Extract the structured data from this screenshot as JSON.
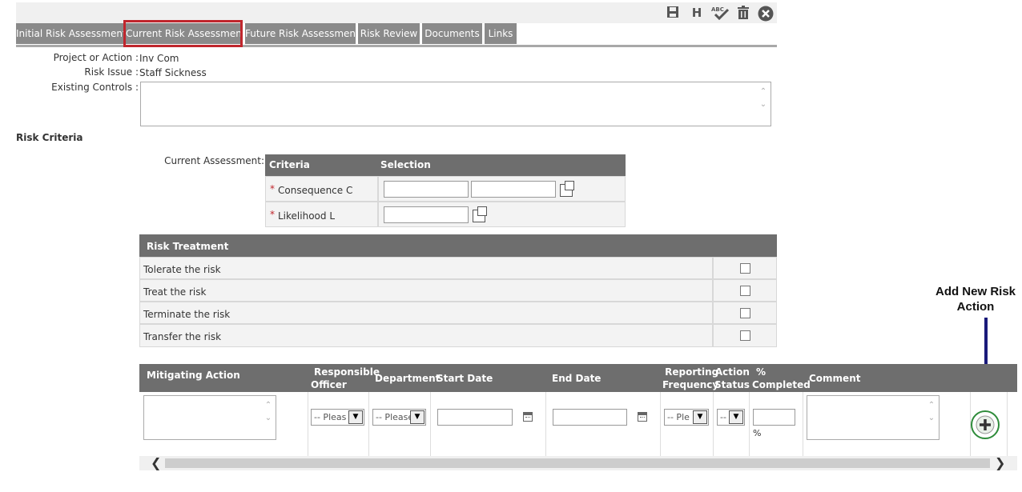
{
  "toolbar": {
    "icons": [
      "save-icon",
      "history-icon",
      "spellcheck-icon",
      "delete-icon",
      "close-icon"
    ],
    "history_label": "H",
    "spell_label": "ABC"
  },
  "tabs": [
    {
      "label": "Initial Risk Assessment"
    },
    {
      "label": "Current Risk Assessment"
    },
    {
      "label": "Future Risk Assessment"
    },
    {
      "label": "Risk Review"
    },
    {
      "label": "Documents"
    },
    {
      "label": "Links"
    }
  ],
  "details": {
    "project_label": "Project or Action :",
    "project_value": "Inv Com",
    "issue_label": "Risk Issue :",
    "issue_value": "Staff Sickness",
    "controls_label": "Existing Controls :",
    "controls_value": ""
  },
  "risk_criteria": {
    "section_title": "Risk Criteria",
    "current_assessment_label": "Current Assessment:",
    "col_criteria": "Criteria",
    "col_selection": "Selection",
    "rows": [
      {
        "required": "*",
        "label": "Consequence C"
      },
      {
        "required": "*",
        "label": "Likelihood L"
      }
    ]
  },
  "risk_treatment": {
    "header": "Risk Treatment",
    "options": [
      {
        "label": "Tolerate the risk",
        "checked": false
      },
      {
        "label": "Treat the risk",
        "checked": false
      },
      {
        "label": "Terminate the risk",
        "checked": false
      },
      {
        "label": "Transfer the risk",
        "checked": false
      }
    ]
  },
  "mitigation": {
    "headers": {
      "mitigating_action": "Mitigating Action",
      "responsible_officer_1": "Responsible",
      "responsible_officer_2": "Officer",
      "department": "Department",
      "start_date": "Start Date",
      "end_date": "End Date",
      "reporting_1": "Reporting",
      "reporting_2": "Frequency",
      "action_1": "Action",
      "action_2": "Status",
      "completed_1": "%",
      "completed_2": "Completed",
      "comment": "Comment"
    },
    "row": {
      "officer_select": "-- Pleas",
      "department_select": "-- Please",
      "frequency_select": "-- Ple",
      "status_select": "--",
      "percent_symbol": "%"
    }
  },
  "annotation": {
    "text_line1": "Add New Risk",
    "text_line2": "Action",
    "color": "#1a1a7a"
  },
  "colors": {
    "tab_bg": "#8a8a8a",
    "header_bg": "#6e6e6e",
    "highlight": "#c0262d",
    "add_button": "#2e8b3a"
  }
}
